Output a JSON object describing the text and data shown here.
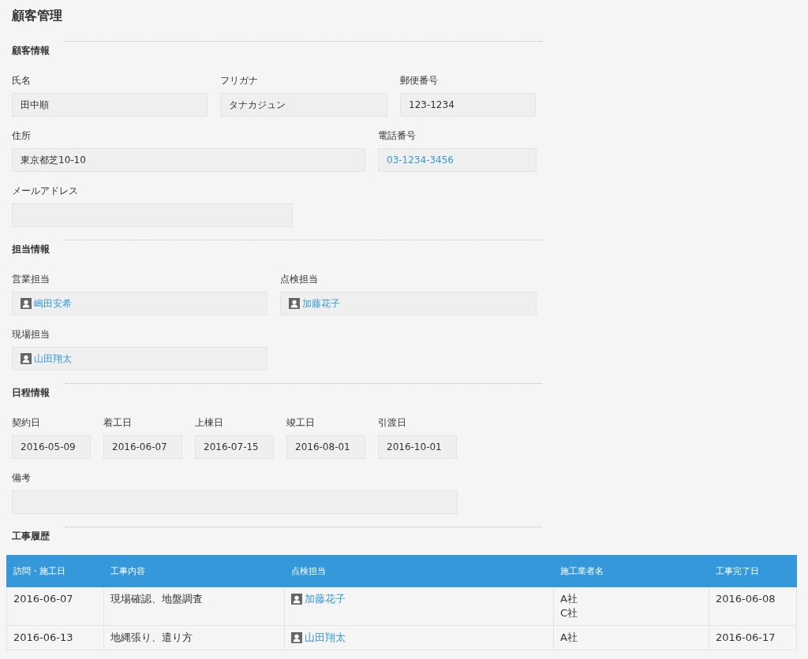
{
  "title": "顧客管理",
  "sections": [
    {
      "title": "顧客情報",
      "fields": [
        {
          "label": "氏名",
          "kind": "text",
          "value": "田中順"
        },
        {
          "label": "フリガナ",
          "kind": "text",
          "value": "タナカジュン"
        },
        {
          "label": "郵便番号",
          "kind": "text",
          "value": "123-1234"
        },
        {
          "label": "住所",
          "kind": "text",
          "value": "東京都芝10-10"
        },
        {
          "label": "電話番号",
          "kind": "link",
          "value": "03-1234-3456"
        },
        {
          "label": "メールアドレス",
          "kind": "text"
        }
      ]
    },
    {
      "title": "担当情報",
      "fields": [
        {
          "label": "営業担当",
          "kind": "user",
          "value": "嶋田安希"
        },
        {
          "label": "点検担当",
          "kind": "user",
          "value": "加藤花子"
        },
        {
          "label": "現場担当",
          "kind": "user",
          "value": "山田翔太"
        }
      ]
    },
    {
      "title": "日程情報",
      "fields": [
        {
          "label": "契約日",
          "kind": "date",
          "value": "2016-05-09"
        },
        {
          "label": "着工日",
          "kind": "date",
          "value": "2016-06-07"
        },
        {
          "label": "上棟日",
          "kind": "date",
          "value": "2016-07-15"
        },
        {
          "label": "竣工日",
          "kind": "date",
          "value": "2016-08-01"
        },
        {
          "label": "引渡日",
          "kind": "date",
          "value": "2016-10-01"
        },
        {
          "label": "備考",
          "kind": "text"
        }
      ]
    }
  ],
  "history": {
    "title": "工事履歴",
    "columns": [
      {
        "label": "訪問・施工日",
        "kind": "text"
      },
      {
        "label": "工事内容",
        "kind": "text"
      },
      {
        "label": "点検担当",
        "kind": "user"
      },
      {
        "label": "施工業者名",
        "kind": "lines"
      },
      {
        "label": "工事完了日",
        "kind": "text"
      }
    ],
    "rows": [
      [
        "2016-06-07",
        "現場確認、地盤調査",
        "加藤花子",
        [
          "A社",
          "C社"
        ],
        "2016-06-08"
      ],
      [
        "2016-06-13",
        "地縄張り、遣り方",
        "山田翔太",
        [
          "A社"
        ],
        "2016-06-17"
      ]
    ]
  }
}
